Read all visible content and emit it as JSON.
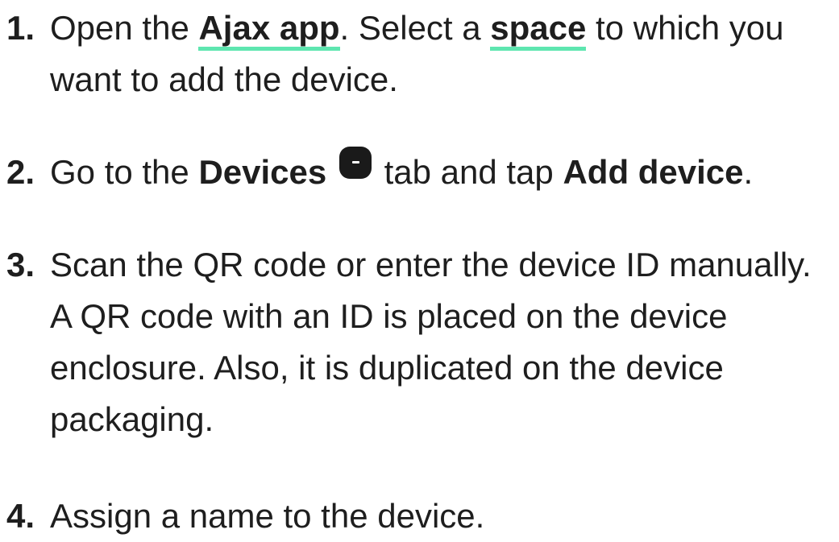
{
  "steps": [
    {
      "number": "1.",
      "parts": {
        "t1": "Open the ",
        "link1": "Ajax app",
        "t2": ". Select a ",
        "link2": "space",
        "t3": " to which you want to add the device."
      }
    },
    {
      "number": "2.",
      "parts": {
        "t1": "Go to the ",
        "b1": "Devices",
        "t2": " tab and tap ",
        "b2": "Add device",
        "t3": "."
      },
      "icon": "devices-tab-icon"
    },
    {
      "number": "3.",
      "parts": {
        "t1": "Scan the QR code or enter the device ID manually. A QR code with an ID is placed on the device enclosure. Also, it is duplicated on the device packaging."
      }
    },
    {
      "number": "4.",
      "parts": {
        "t1": "Assign a name to the device."
      }
    }
  ],
  "colors": {
    "text": "#1e1e1e",
    "link_underline": "#5ee6b0",
    "icon_bg": "#1a1a1a"
  }
}
